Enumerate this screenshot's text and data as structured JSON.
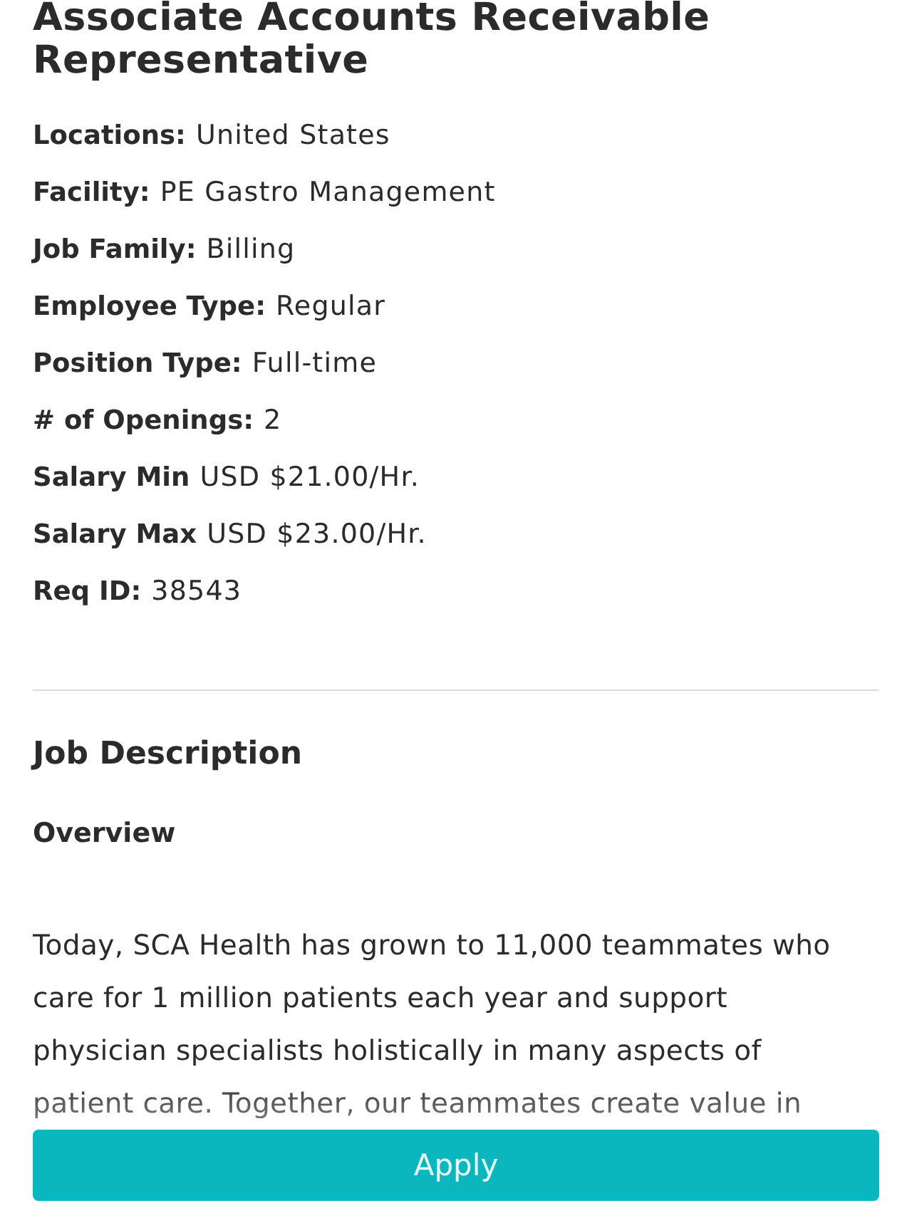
{
  "job_title": "Associate Accounts Receivable Representative",
  "details": [
    {
      "label": "Locations:",
      "value": "United States"
    },
    {
      "label": "Facility:",
      "value": "PE Gastro Management"
    },
    {
      "label": "Job Family:",
      "value": "Billing"
    },
    {
      "label": "Employee Type:",
      "value": "Regular"
    },
    {
      "label": "Position Type:",
      "value": "Full-time"
    },
    {
      "label": "# of Openings:",
      "value": "2"
    },
    {
      "label": "Salary Min",
      "value": "USD $21.00/Hr."
    },
    {
      "label": "Salary Max",
      "value": "USD $23.00/Hr."
    },
    {
      "label": "Req ID:",
      "value": "38543"
    }
  ],
  "description": {
    "heading": "Job Description",
    "subheading": "Overview",
    "paragraph": "Today, SCA Health has grown to 11,000 teammates who care for 1 million patients each year and support physician specialists holistically in many aspects of patient care. Together, our teammates create value in"
  },
  "apply_button": {
    "label": "Apply"
  }
}
